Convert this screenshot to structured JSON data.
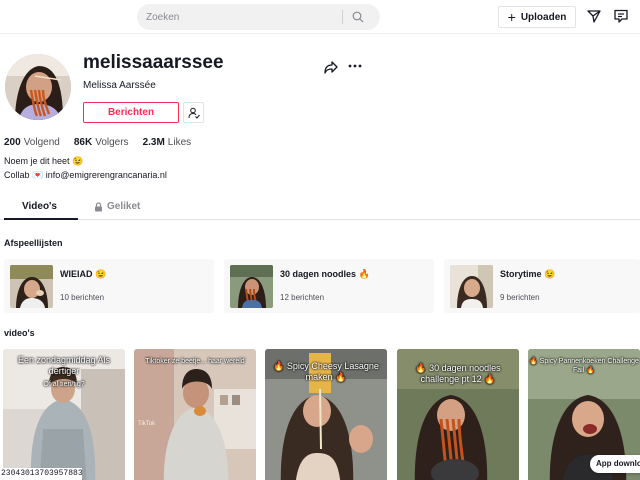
{
  "search": {
    "placeholder": "Zoeken"
  },
  "header": {
    "upload_label": "Uploaden"
  },
  "profile": {
    "username": "melissaaarssee",
    "display_name": "Melissa Aarssée",
    "message_button": "Berichten",
    "stats": [
      {
        "value": "200",
        "label": "Volgend"
      },
      {
        "value": "86K",
        "label": "Volgers"
      },
      {
        "value": "2.3M",
        "label": "Likes"
      }
    ],
    "bio": [
      "Noem je dit heet 😉",
      "Collab 💌 info@emigrerengrancanaria.nl"
    ]
  },
  "tabs": [
    {
      "label": "Video's"
    },
    {
      "label": "Geliket"
    }
  ],
  "playlists_title": "Afspeellijsten",
  "playlists": [
    {
      "title": "WIEIAD 😉",
      "count": "10 berichten"
    },
    {
      "title": "30 dagen noodles 🔥",
      "count": "12 berichten"
    },
    {
      "title": "Storytime 😉",
      "count": "9 berichten"
    }
  ],
  "videos_title": "video's",
  "videos": [
    {
      "caption": "Een zondagmiddag Als dertiger",
      "sub": "Of al tien/tig?"
    },
    {
      "caption": "Tiktoker ze beetje... haar wereld",
      "sub": ""
    },
    {
      "caption": "🔥 Spicy Cheesy Lasagne maken 🔥",
      "sub": ""
    },
    {
      "caption": "🔥 30 dagen noodles challenge pt 12 🔥",
      "sub": ""
    },
    {
      "caption": "🔥 Spicy Pannenkoeken Challenge Fail 🔥",
      "sub": ""
    }
  ],
  "video_id": "23043013703957883",
  "app_download": "App downlo",
  "tiktok_watermark": "TikTok",
  "colors": {
    "accent": "#fe2c55",
    "text": "#161823"
  }
}
